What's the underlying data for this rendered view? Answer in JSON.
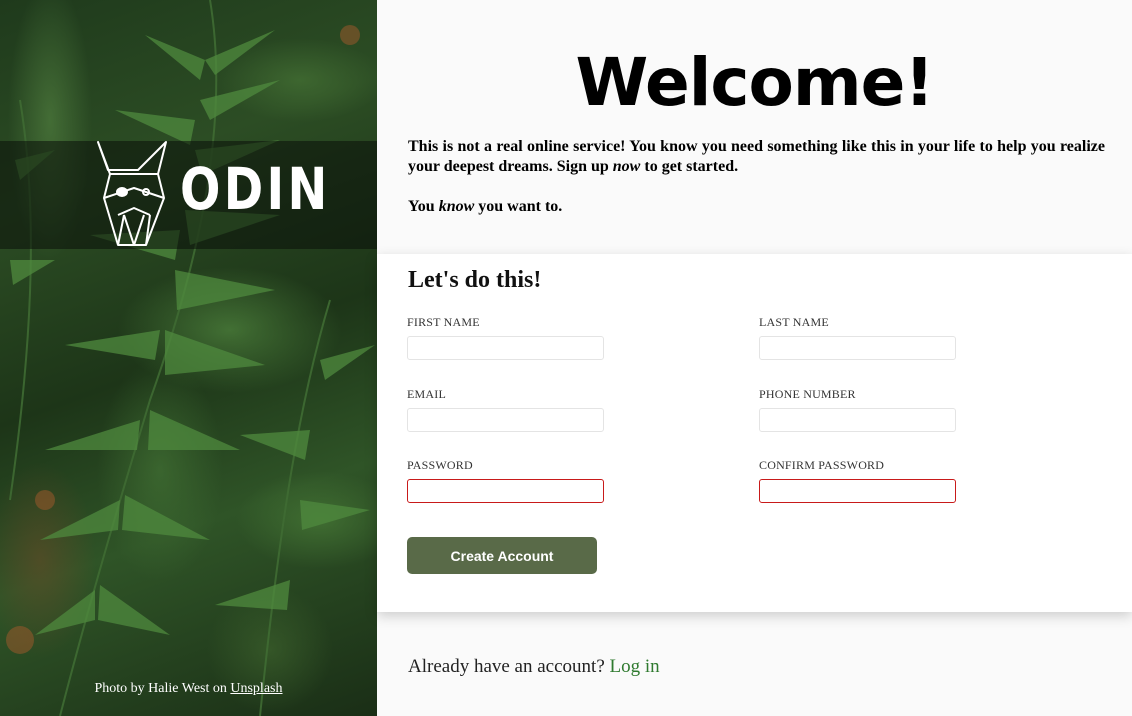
{
  "hero": {
    "brand_name": "ODIN",
    "credit": {
      "prefix": "Photo by Halie West on ",
      "link": "Unsplash"
    }
  },
  "main": {
    "title": "Welcome!",
    "intro": {
      "p1": "This is not a real online service! You know you need something like this in your life to help you realize your deepest dreams. Sign up ",
      "p1_em": "now",
      "p1_end": " to get started.",
      "p2_start": "You ",
      "p2_em": "know",
      "p2_end": " you want to."
    }
  },
  "form": {
    "title": "Let's do this!",
    "fields": [
      {
        "label": "FIRST NAME",
        "value": ""
      },
      {
        "label": "LAST NAME",
        "value": ""
      },
      {
        "label": "EMAIL",
        "value": ""
      },
      {
        "label": "PHONE NUMBER",
        "value": ""
      },
      {
        "label": "PASSWORD",
        "value": ""
      },
      {
        "label": "CONFIRM PASSWORD",
        "value": ""
      }
    ],
    "submit_label": "Create Account"
  },
  "footer": {
    "prompt": "Already have an account? ",
    "link": "Log in"
  },
  "colors": {
    "button": "#596a48",
    "link": "#2f7a2f",
    "invalid_border": "#c81a1a"
  }
}
